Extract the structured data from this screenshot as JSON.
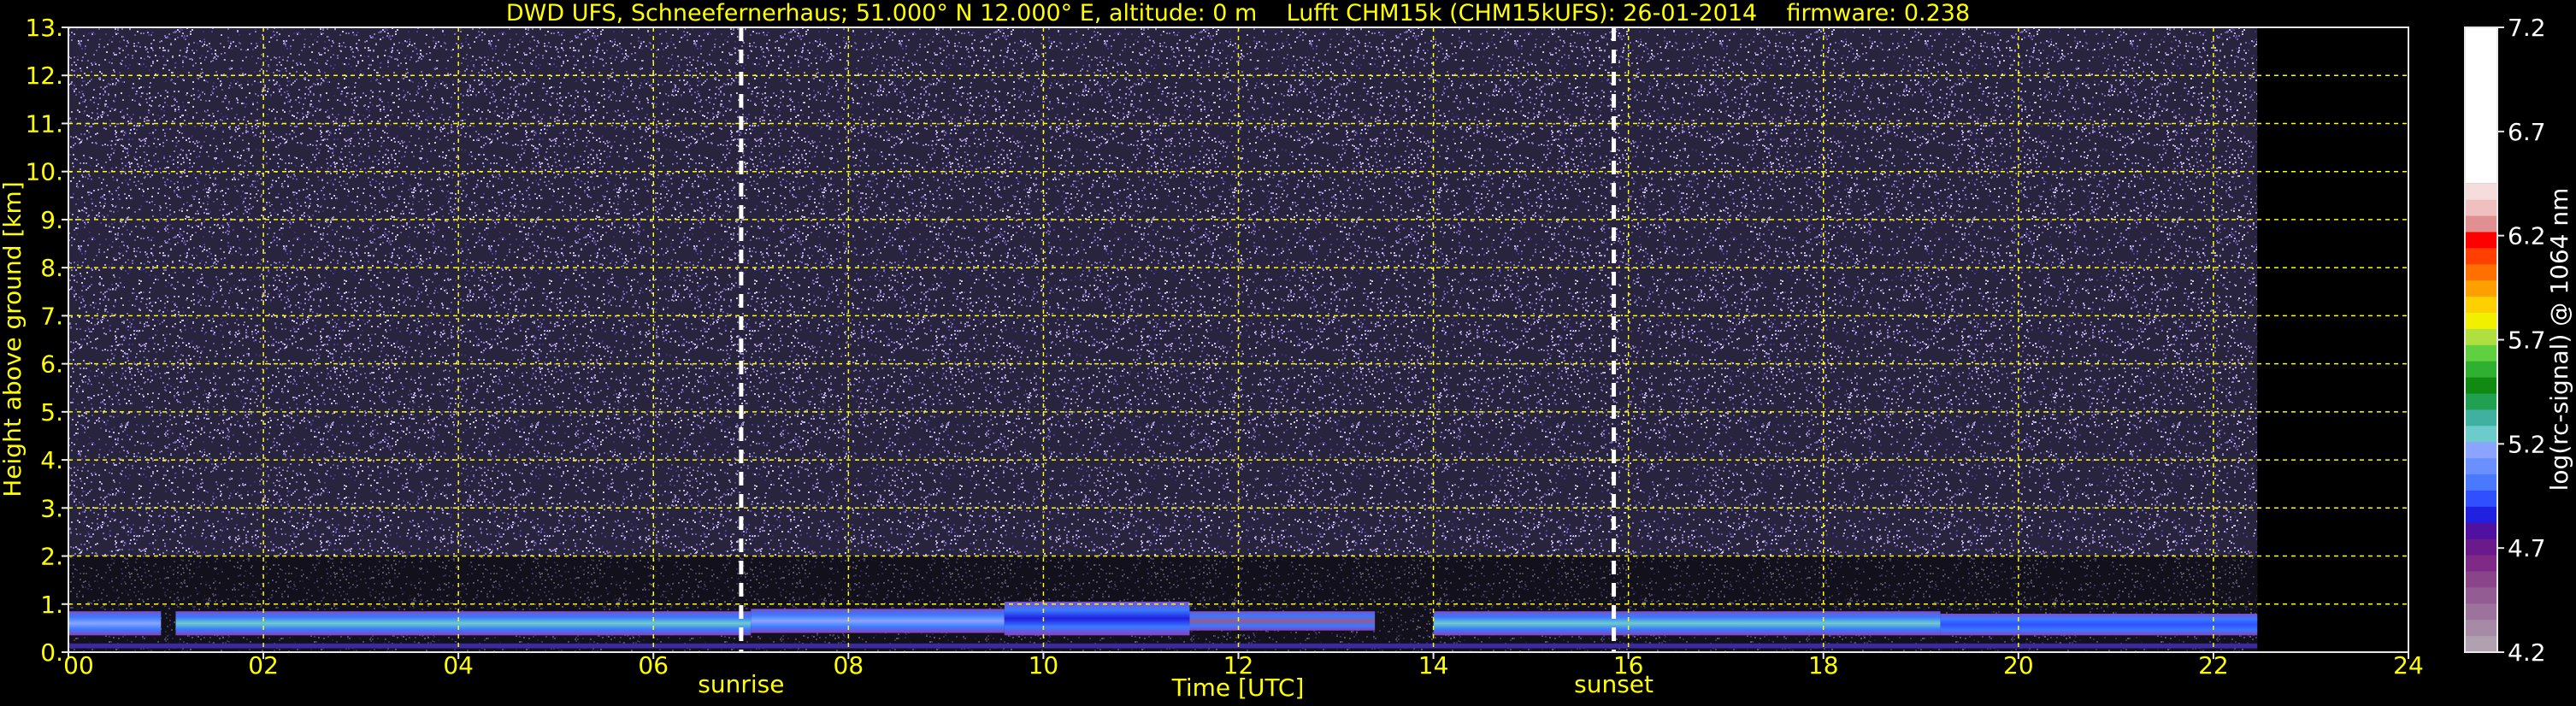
{
  "chart_data": {
    "type": "heatmap",
    "title": "DWD UFS, Schneefernerhaus; 51.000° N 12.000° E, altitude: 0 m    Lufft CHM15k (CHM15kUFS): 26-01-2014    firmware: 0.238",
    "xlabel": "Time [UTC]",
    "ylabel": "Height above ground [km]",
    "xlim": [
      0,
      24
    ],
    "ylim": [
      0,
      13
    ],
    "x_ticks": [
      "00",
      "02",
      "04",
      "06",
      "08",
      "10",
      "12",
      "14",
      "16",
      "18",
      "20",
      "22",
      "24"
    ],
    "y_ticks": [
      "0.",
      "1.",
      "2.",
      "3.",
      "4.",
      "5.",
      "6.",
      "7.",
      "8.",
      "9.",
      "10.",
      "11.",
      "12.",
      "13."
    ],
    "grid": true,
    "data_end_hour": 22.45,
    "markers": [
      {
        "label": "sunrise",
        "x": 6.9
      },
      {
        "label": "sunset",
        "x": 15.85
      }
    ],
    "colorbar": {
      "label": "log(rc-signal) @ 1064 nm",
      "range": [
        4.2,
        7.2
      ],
      "ticks": [
        "4.2",
        "4.7",
        "5.2",
        "5.7",
        "6.2",
        "6.7",
        "7.2"
      ],
      "colors": [
        "#b0a0b0",
        "#a68aa6",
        "#9c739c",
        "#935c93",
        "#8a448a",
        "#7e2a86",
        "#6a1a8a",
        "#5010a0",
        "#2020e0",
        "#3050ff",
        "#4a78ff",
        "#6a90ff",
        "#8aa4ff",
        "#6ccccc",
        "#40b0a0",
        "#20a050",
        "#108a10",
        "#30b030",
        "#60d040",
        "#b0e040",
        "#f0f000",
        "#ffd000",
        "#ffa000",
        "#ff7000",
        "#ff4000",
        "#ff0000",
        "#e09090",
        "#f0c0c0",
        "#f5dddd"
      ]
    },
    "cloud_layers": [
      {
        "x_start": 0.0,
        "x_end": 0.95,
        "y_bottom": 0.35,
        "y_top": 0.85,
        "level": 5.5
      },
      {
        "x_start": 1.1,
        "x_end": 7.0,
        "y_bottom": 0.35,
        "y_top": 0.85,
        "level": 5.6
      },
      {
        "x_start": 7.0,
        "x_end": 9.6,
        "y_bottom": 0.4,
        "y_top": 0.9,
        "level": 5.5
      },
      {
        "x_start": 9.6,
        "x_end": 11.5,
        "y_bottom": 0.35,
        "y_top": 1.05,
        "level": 5.1
      },
      {
        "x_start": 11.5,
        "x_end": 13.4,
        "y_bottom": 0.45,
        "y_top": 0.85,
        "level": 4.6
      },
      {
        "x_start": 14.0,
        "x_end": 19.2,
        "y_bottom": 0.35,
        "y_top": 0.85,
        "level": 5.6
      },
      {
        "x_start": 19.2,
        "x_end": 22.45,
        "y_bottom": 0.35,
        "y_top": 0.8,
        "level": 5.2
      }
    ]
  }
}
